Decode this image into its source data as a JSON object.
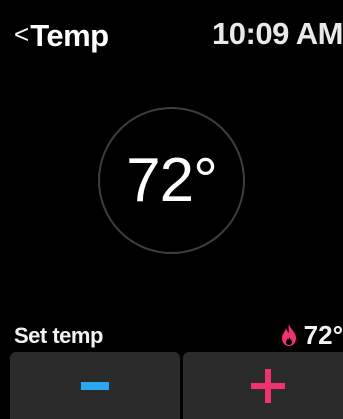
{
  "header": {
    "back_glyph": "<",
    "title": "Temp",
    "time": "10:09 AM"
  },
  "dial": {
    "current_temp": "72°"
  },
  "setpoint": {
    "label": "Set temp",
    "value": "72°",
    "mode_icon": "flame-icon",
    "mode_color": "#f0326e"
  },
  "controls": {
    "decrease_icon": "minus-icon",
    "increase_icon": "plus-icon",
    "decrease_color": "#2aa9f0",
    "increase_color": "#f0326e"
  }
}
